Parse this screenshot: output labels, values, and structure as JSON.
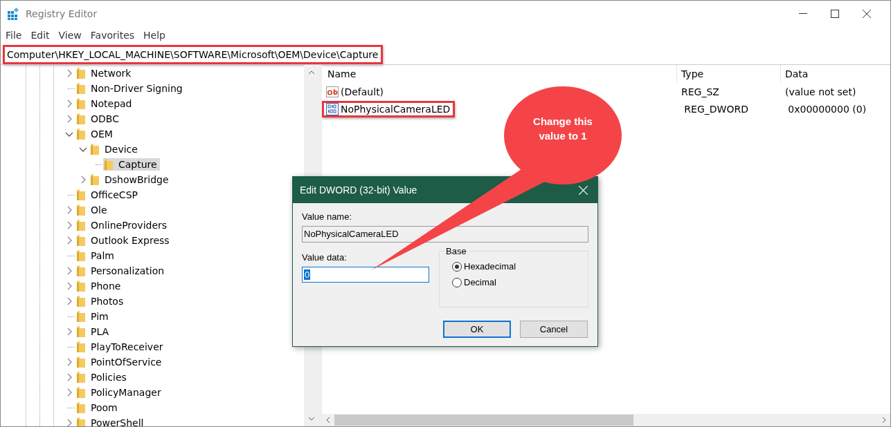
{
  "window": {
    "title": "Registry Editor"
  },
  "menu": [
    "File",
    "Edit",
    "View",
    "Favorites",
    "Help"
  ],
  "address_bar": {
    "path": "Computer\\HKEY_LOCAL_MACHINE\\SOFTWARE\\Microsoft\\OEM\\Device\\Capture",
    "highlighted": true
  },
  "tree": [
    {
      "label": "Network",
      "kind": "collapsed",
      "selected": false
    },
    {
      "label": "Non-Driver Signing",
      "kind": "leaf",
      "selected": false
    },
    {
      "label": "Notepad",
      "kind": "collapsed",
      "selected": false
    },
    {
      "label": "ODBC",
      "kind": "collapsed",
      "selected": false
    },
    {
      "label": "OEM",
      "kind": "expanded",
      "selected": false,
      "children": [
        {
          "label": "Device",
          "kind": "expanded",
          "selected": false,
          "children": [
            {
              "label": "Capture",
              "kind": "leaf",
              "selected": true
            }
          ]
        },
        {
          "label": "DshowBridge",
          "kind": "collapsed",
          "selected": false
        }
      ]
    },
    {
      "label": "OfficeCSP",
      "kind": "leaf",
      "selected": false
    },
    {
      "label": "Ole",
      "kind": "collapsed",
      "selected": false
    },
    {
      "label": "OnlineProviders",
      "kind": "collapsed",
      "selected": false
    },
    {
      "label": "Outlook Express",
      "kind": "collapsed",
      "selected": false
    },
    {
      "label": "Palm",
      "kind": "leaf",
      "selected": false
    },
    {
      "label": "Personalization",
      "kind": "collapsed",
      "selected": false
    },
    {
      "label": "Phone",
      "kind": "collapsed",
      "selected": false
    },
    {
      "label": "Photos",
      "kind": "collapsed",
      "selected": false
    },
    {
      "label": "Pim",
      "kind": "leaf",
      "selected": false
    },
    {
      "label": "PLA",
      "kind": "collapsed",
      "selected": false
    },
    {
      "label": "PlayToReceiver",
      "kind": "leaf",
      "selected": false
    },
    {
      "label": "PointOfService",
      "kind": "collapsed",
      "selected": false
    },
    {
      "label": "Policies",
      "kind": "collapsed",
      "selected": false
    },
    {
      "label": "PolicyManager",
      "kind": "collapsed",
      "selected": false
    },
    {
      "label": "Poom",
      "kind": "leaf",
      "selected": false
    },
    {
      "label": "PowerShell",
      "kind": "collapsed",
      "selected": false
    }
  ],
  "table": {
    "columns": [
      "Name",
      "Type",
      "Data"
    ],
    "rows": [
      {
        "kind": "string",
        "name": "(Default)",
        "type": "REG_SZ",
        "data": "(value not set)",
        "highlighted": false
      },
      {
        "kind": "binary",
        "name": "NoPhysicalCameraLED",
        "type": "REG_DWORD",
        "data": "0x00000000 (0)",
        "highlighted": true
      }
    ]
  },
  "dialog": {
    "title": "Edit DWORD (32-bit) Value",
    "value_name_label": "Value name:",
    "value_name": "NoPhysicalCameraLED",
    "value_data_label": "Value data:",
    "value_data": "0",
    "base_label": "Base",
    "bases": [
      {
        "label": "Hexadecimal",
        "selected": true
      },
      {
        "label": "Decimal",
        "selected": false
      }
    ],
    "buttons": [
      {
        "label": "OK",
        "default": true
      },
      {
        "label": "Cancel",
        "default": false
      }
    ]
  },
  "callout": {
    "text": "Change this value to 1"
  }
}
